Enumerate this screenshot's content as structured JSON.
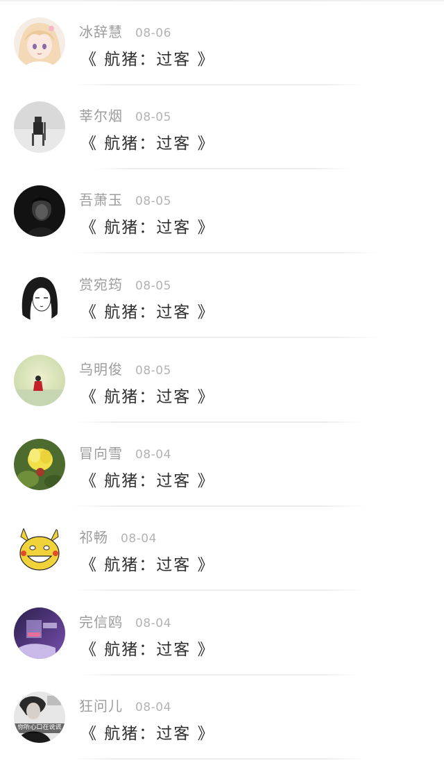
{
  "feed": {
    "items": [
      {
        "name": "冰辞慧",
        "date": "08-06",
        "title": "《 航猪：过客 》",
        "avatar_icon": "anime-girl-avatar-icon"
      },
      {
        "name": "莘尔烟",
        "date": "08-05",
        "title": "《 航猪：过客 》",
        "avatar_icon": "figure-on-chair-avatar-icon"
      },
      {
        "name": "吾萧玉",
        "date": "08-05",
        "title": "《 航猪：过客 》",
        "avatar_icon": "dark-portrait-avatar-icon"
      },
      {
        "name": "赏宛筠",
        "date": "08-05",
        "title": "《 航猪：过客 》",
        "avatar_icon": "manga-woman-avatar-icon"
      },
      {
        "name": "乌明俊",
        "date": "08-05",
        "title": "《 航猪：过客 》",
        "avatar_icon": "red-figure-avatar-icon"
      },
      {
        "name": "冒向雪",
        "date": "08-04",
        "title": "《 航猪：过客 》",
        "avatar_icon": "yellow-flower-avatar-icon"
      },
      {
        "name": "祁畅",
        "date": "08-04",
        "title": "《 航猪：过客 》",
        "avatar_icon": "yellow-meme-face-avatar-icon"
      },
      {
        "name": "完信鸥",
        "date": "08-04",
        "title": "《 航猪：过客 》",
        "avatar_icon": "purple-hand-avatar-icon"
      },
      {
        "name": "狂问儿",
        "date": "08-04",
        "title": "《 航猪：过客 》",
        "avatar_icon": "text-photo-avatar-icon",
        "avatar_text": "你听心口在说谎"
      }
    ]
  },
  "colors": {
    "name": "#9c9c9c",
    "date": "#b3b3b3",
    "title": "#2f2f2f",
    "divider": "#ececec",
    "background": "#ffffff"
  }
}
